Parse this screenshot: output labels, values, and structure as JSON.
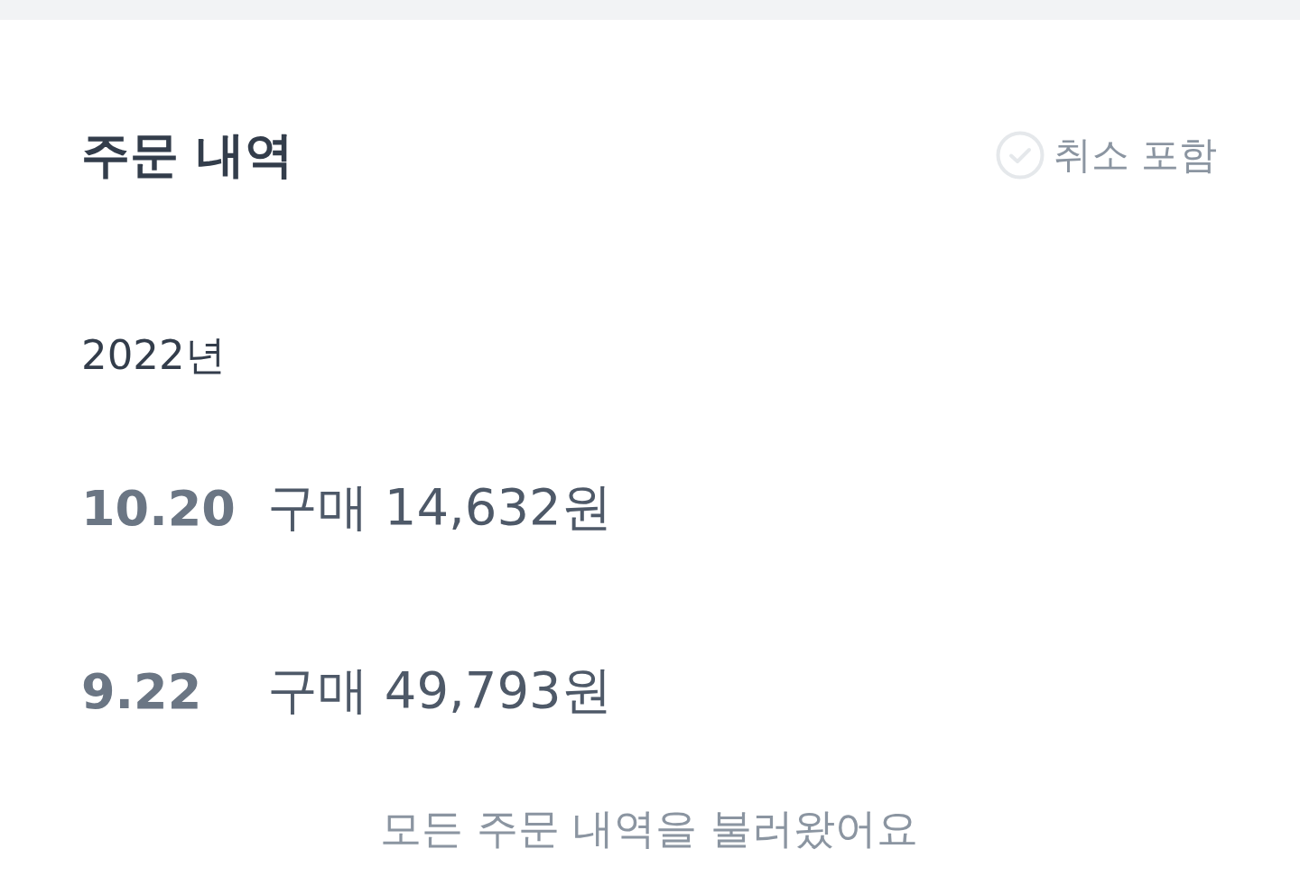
{
  "header": {
    "title": "주문 내역",
    "include_cancelled": {
      "label": "취소 포함",
      "checked": false
    }
  },
  "groups": [
    {
      "year": "2022년",
      "orders": [
        {
          "date": "10.20",
          "summary": "구매 14,632원"
        },
        {
          "date": "9.22",
          "summary": "구매 49,793원"
        }
      ]
    }
  ],
  "footer": {
    "message": "모든 주문 내역을 불러왔어요"
  }
}
